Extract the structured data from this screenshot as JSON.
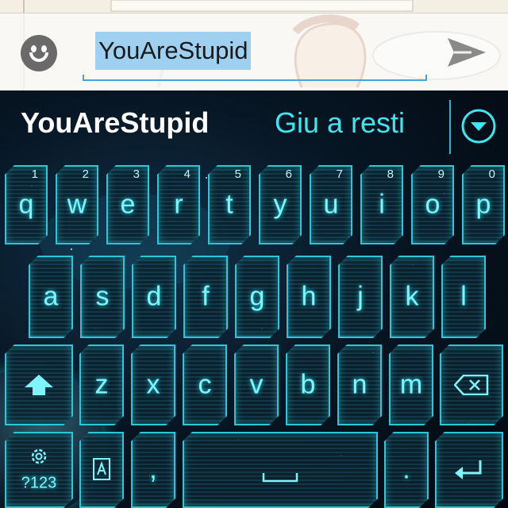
{
  "compose": {
    "input_value": "YouAreStupid",
    "emoji_icon": "smiley-icon",
    "send_icon": "send-icon"
  },
  "keyboard": {
    "suggestions": [
      "YouAreStupid",
      "Giu a resti"
    ],
    "expand_icon": "chevron-down-circle-icon",
    "row1": [
      {
        "label": "q",
        "hint": "1"
      },
      {
        "label": "w",
        "hint": "2"
      },
      {
        "label": "e",
        "hint": "3"
      },
      {
        "label": "r",
        "hint": "4"
      },
      {
        "label": "t",
        "hint": "5"
      },
      {
        "label": "y",
        "hint": "6"
      },
      {
        "label": "u",
        "hint": "7"
      },
      {
        "label": "i",
        "hint": "8"
      },
      {
        "label": "o",
        "hint": "9"
      },
      {
        "label": "p",
        "hint": "0"
      }
    ],
    "row2": [
      "a",
      "s",
      "d",
      "f",
      "g",
      "h",
      "j",
      "k",
      "l"
    ],
    "row3": [
      "z",
      "x",
      "c",
      "v",
      "b",
      "n",
      "m"
    ],
    "shift_icon": "shift-arrow-icon",
    "backspace_icon": "backspace-icon",
    "symbols_label": "?123",
    "settings_icon": "gear-icon",
    "language_icon": "language-a-icon",
    "comma_label": ",",
    "space_icon": "space-bar-icon",
    "period_label": ".",
    "enter_icon": "enter-return-icon"
  },
  "colors": {
    "key_border": "#2bc7d8",
    "key_text": "#7ff4fb",
    "suggestion_primary": "#ffffff",
    "suggestion_secondary": "#3ee6f0",
    "selection_highlight": "#9fd0ef"
  }
}
